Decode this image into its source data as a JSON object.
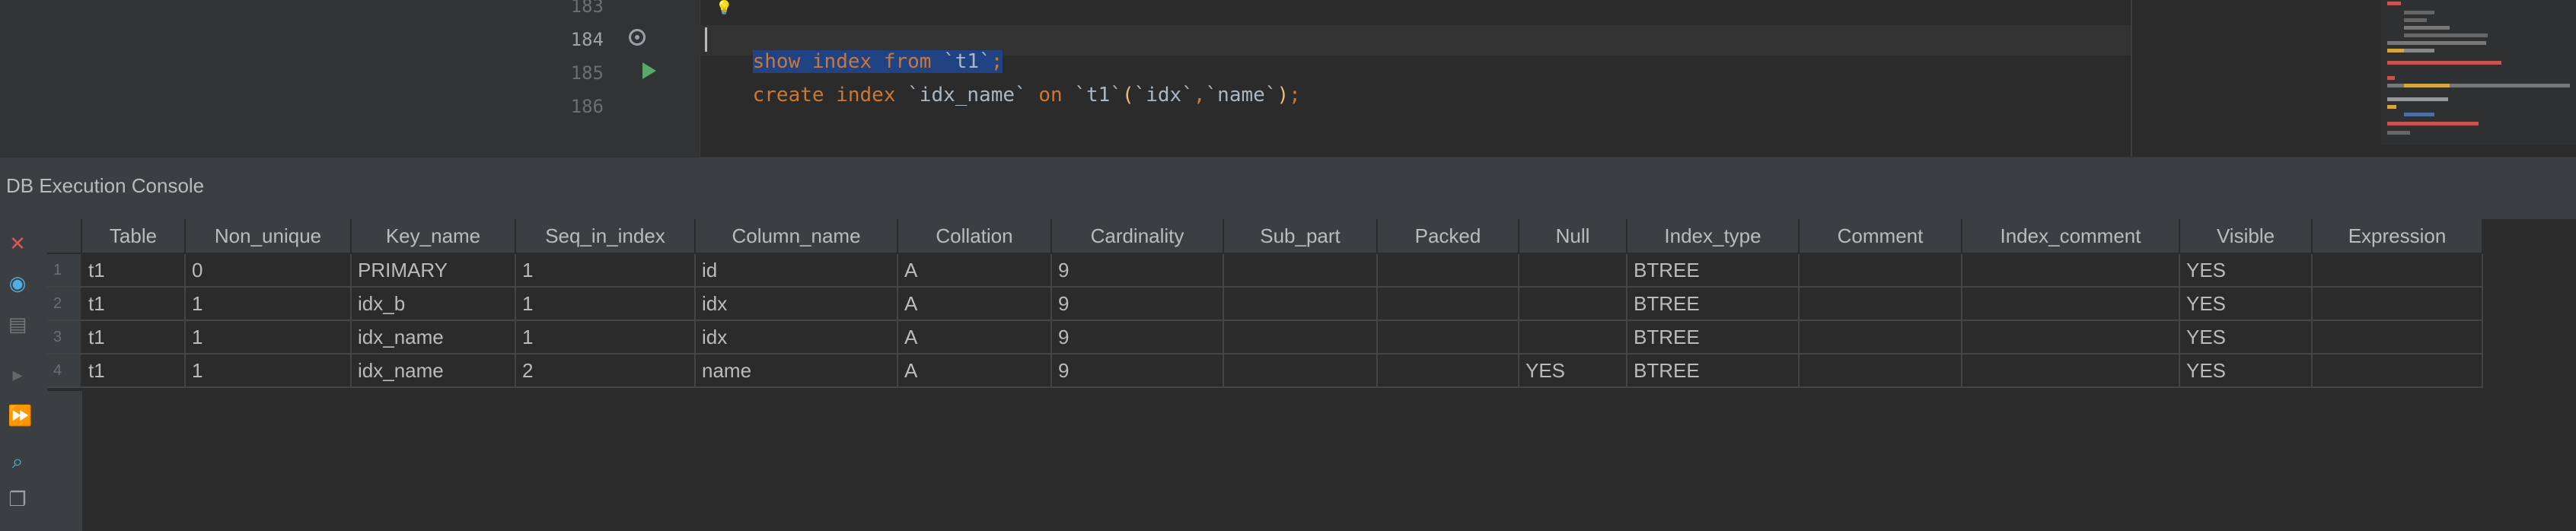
{
  "editor": {
    "line_numbers": [
      "183",
      "184",
      "185",
      "186"
    ],
    "line184": {
      "kw1": "show",
      "kw2": "index",
      "kw3": "from",
      "ident": "`t1`",
      "end": ";"
    },
    "line185": {
      "kw1": "create",
      "kw2": "index",
      "name": "`idx_name`",
      "kw3": "on",
      "table": "`t1`",
      "open": "(",
      "col1": "`idx`",
      "comma": ",",
      "col2": "`name`",
      "close": ")",
      "end": ";"
    }
  },
  "console": {
    "title": "DB Execution Console",
    "columns": [
      "Table",
      "Non_unique",
      "Key_name",
      "Seq_in_index",
      "Column_name",
      "Collation",
      "Cardinality",
      "Sub_part",
      "Packed",
      "Null",
      "Index_type",
      "Comment",
      "Index_comment",
      "Visible",
      "Expression"
    ],
    "rows": [
      {
        "num": "1",
        "cells": [
          "t1",
          "0",
          "PRIMARY",
          "1",
          "id",
          "A",
          "9",
          "",
          "",
          "",
          "BTREE",
          "",
          "",
          "YES",
          ""
        ]
      },
      {
        "num": "2",
        "cells": [
          "t1",
          "1",
          "idx_b",
          "1",
          "idx",
          "A",
          "9",
          "",
          "",
          "",
          "BTREE",
          "",
          "",
          "YES",
          ""
        ]
      },
      {
        "num": "3",
        "cells": [
          "t1",
          "1",
          "idx_name",
          "1",
          "idx",
          "A",
          "9",
          "",
          "",
          "",
          "BTREE",
          "",
          "",
          "YES",
          ""
        ]
      },
      {
        "num": "4",
        "cells": [
          "t1",
          "1",
          "idx_name",
          "2",
          "name",
          "A",
          "9",
          "",
          "",
          "YES",
          "BTREE",
          "",
          "",
          "YES",
          ""
        ]
      }
    ]
  },
  "toolbar_icons": [
    "close-icon",
    "eye-icon",
    "layout-icon",
    "step-icon",
    "run-all-icon",
    "search-icon",
    "copy-icon"
  ],
  "colors": {
    "keyword": "#cc7832",
    "selection": "#214283",
    "run": "#59a869",
    "close": "#e05555",
    "accent": "#4eade5"
  }
}
